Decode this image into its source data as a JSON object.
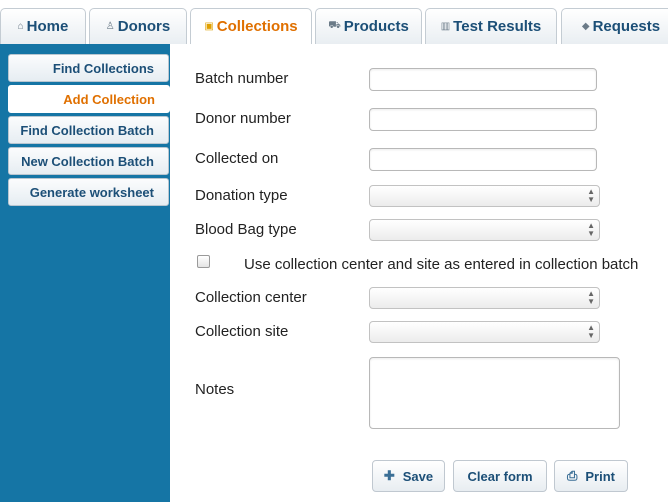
{
  "tabs": [
    {
      "label": "Home",
      "icon": "home-icon",
      "glyph": "⌂",
      "active": false
    },
    {
      "label": "Donors",
      "icon": "user-icon",
      "glyph": "♙",
      "active": false
    },
    {
      "label": "Collections",
      "icon": "bag-icon",
      "glyph": "▣",
      "active": true
    },
    {
      "label": "Products",
      "icon": "cart-icon",
      "glyph": "⛟",
      "active": false
    },
    {
      "label": "Test Results",
      "icon": "chart-icon",
      "glyph": "▥",
      "active": false
    },
    {
      "label": "Requests",
      "icon": "tag-icon",
      "glyph": "◆",
      "active": false
    }
  ],
  "sidebar": {
    "items": [
      {
        "label": "Find Collections",
        "active": false
      },
      {
        "label": "Add Collection",
        "active": true
      },
      {
        "label": "Find Collection Batch",
        "active": false
      },
      {
        "label": "New Collection Batch",
        "active": false
      },
      {
        "label": "Generate worksheet",
        "active": false
      }
    ]
  },
  "form": {
    "batch_number": {
      "label": "Batch number",
      "value": ""
    },
    "donor_number": {
      "label": "Donor number",
      "value": ""
    },
    "collected_on": {
      "label": "Collected on",
      "value": ""
    },
    "donation_type": {
      "label": "Donation type",
      "selected": ""
    },
    "blood_bag_type": {
      "label": "Blood Bag type",
      "selected": ""
    },
    "use_batch_center": {
      "label": "Use collection center and site as entered in collection batch",
      "checked": false
    },
    "collection_center": {
      "label": "Collection center",
      "selected": ""
    },
    "collection_site": {
      "label": "Collection site",
      "selected": ""
    },
    "notes": {
      "label": "Notes",
      "value": ""
    }
  },
  "buttons": {
    "save": {
      "label": "Save",
      "icon": "plus-icon",
      "glyph": "✚"
    },
    "clear": {
      "label": "Clear form"
    },
    "print": {
      "label": "Print",
      "icon": "printer-icon",
      "glyph": "⎙"
    }
  },
  "colors": {
    "sidebar_bg": "#1575a5",
    "active_text": "#e07000",
    "link_text": "#1c4f77"
  }
}
